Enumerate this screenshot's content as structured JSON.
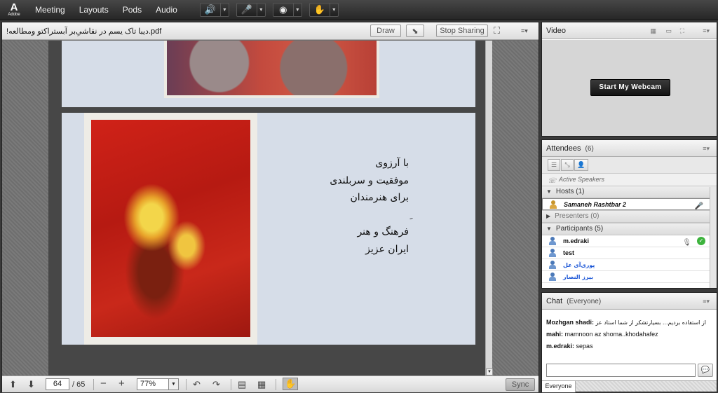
{
  "topbar": {
    "logo_glyph": "A",
    "logo_word": "Adobe",
    "menus": [
      "Meeting",
      "Layouts",
      "Pods",
      "Audio"
    ]
  },
  "share_pod": {
    "file_title": "!دیبا تاک یسم در نقاشیِ‌بر آبستراکتو ومطالعه.pdf",
    "draw_label": "Draw",
    "stop_sharing_label": "Stop Sharing",
    "poem_lines": [
      "با آرزوی",
      "موفقیت و سربلندی",
      "برای هنرمندان",
      "ِ",
      "فرهنگ و هنر",
      "ایران عزیز"
    ],
    "page_current": "64",
    "page_total": "/ 65",
    "zoom_value": "77%",
    "sync_label": "Sync"
  },
  "video_pod": {
    "title": "Video",
    "webcam_label": "Start My Webcam"
  },
  "attendees_pod": {
    "title": "Attendees",
    "count": "(6)",
    "active_speakers": "Active Speakers",
    "hosts_label": "Hosts (1)",
    "host_name": "Samaneh Rashtbar 2",
    "presenters_label": "Presenters (0)",
    "participants_label": "Participants (5)",
    "participants": [
      "m.edraki",
      "test",
      "پوری‌آی عل",
      "بیرز النصار"
    ]
  },
  "chat_pod": {
    "title": "Chat",
    "subtitle": "(Everyone)",
    "messages": [
      {
        "sender": "Mozhgan shadi:",
        "text": "از استفاده بردیم... بسیارتشکر از شما استاد عز"
      },
      {
        "sender": "mahi:",
        "text": "mamnoon az shoma..khodahafez"
      },
      {
        "sender": "m.edraki:",
        "text": "sepas"
      }
    ],
    "tab_label": "Everyone"
  },
  "colors": {
    "topbar_bg": "#2e2e2e",
    "audio_green": "#3bd23b",
    "link_blue": "#1a55d6"
  }
}
